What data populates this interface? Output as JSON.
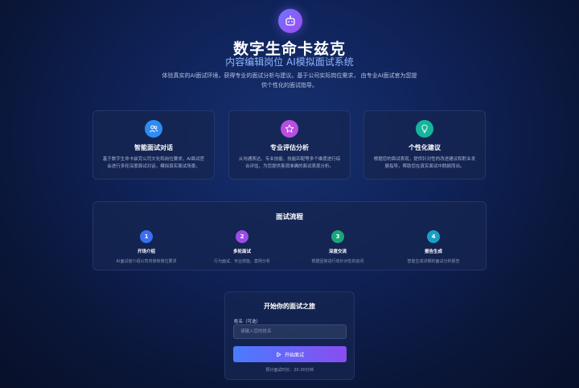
{
  "hero": {
    "icon": "robot-icon",
    "title": "数字生命卡兹克",
    "subtitle": "内容编辑岗位 AI模拟面试系统",
    "description": "体验真实的AI面试环境，获得专业的面试分析与建议。基于公司实际岗位需求， 由专业AI面试官为您提供个性化的面试指导。"
  },
  "features": [
    {
      "icon": "users-icon",
      "color": "#2f8cf0",
      "title": "智能面试对话",
      "description": "基于数字生命卡兹克公司文化和岗位要求，AI面试官会进行多轮深度面试对话，模拟真实面试场景。"
    },
    {
      "icon": "star-icon",
      "color": "#b84fe0",
      "title": "专业评估分析",
      "description": "从沟通表达、专业技能、技能匹配等多个维度进行综合评估，为您提供客观准确的面试表现分析。"
    },
    {
      "icon": "lightbulb-icon",
      "color": "#16b59a",
      "title": "个性化建议",
      "description": "根据您的面试表现，提供针对性的改进建议和职业发展指导，帮助您在真实面试中脱颖而出。"
    }
  ],
  "process": {
    "title": "面试流程",
    "steps": [
      {
        "num": "1",
        "color": "#3b6ff0",
        "title": "开场介绍",
        "description": "AI面试官介绍公司背景和岗位要求"
      },
      {
        "num": "2",
        "color": "#9b4ce8",
        "title": "多轮面试",
        "description": "行为面试、专业技能、案例分析"
      },
      {
        "num": "3",
        "color": "#1aa57a",
        "title": "深度交流",
        "description": "根据回答进行有针对性的追问"
      },
      {
        "num": "4",
        "color": "#1a9ec4",
        "title": "报告生成",
        "description": "智能生成详细的面试分析报告"
      }
    ]
  },
  "start": {
    "title": "开始你的面试之旅",
    "name_label": "姓名（可选）",
    "name_placeholder": "请输入您的姓名",
    "button_label": "开始面试",
    "button_icon": "play-icon",
    "hint": "预计面试时长：20-30分钟"
  }
}
